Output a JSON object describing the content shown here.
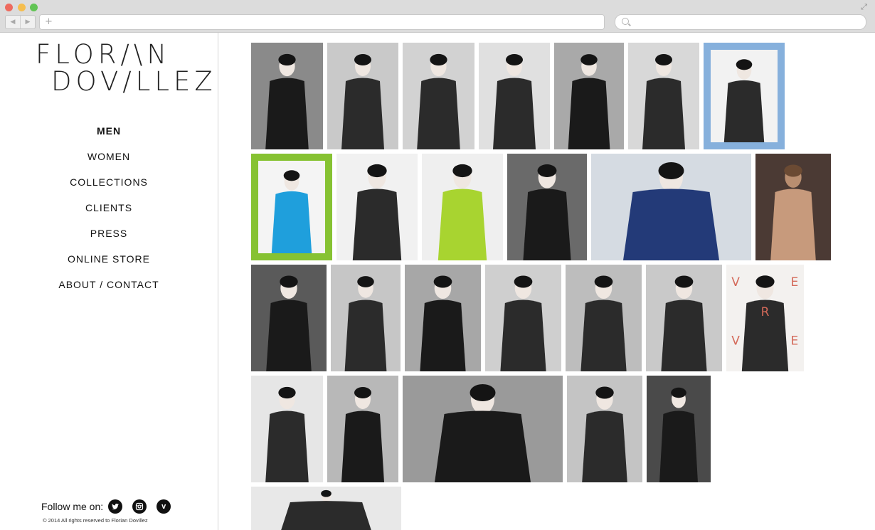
{
  "browser": {
    "url": "",
    "search_placeholder": ""
  },
  "site": {
    "logo_line1": "FLOR/\\N",
    "logo_line2": "DOV/LLEZ"
  },
  "nav": {
    "items": [
      {
        "label": "MEN",
        "active": true
      },
      {
        "label": "WOMEN",
        "active": false
      },
      {
        "label": "COLLECTIONS",
        "active": false
      },
      {
        "label": "CLIENTS",
        "active": false
      },
      {
        "label": "PRESS",
        "active": false
      },
      {
        "label": "ONLINE STORE",
        "active": false
      },
      {
        "label": "ABOUT / CONTACT",
        "active": false
      }
    ]
  },
  "footer": {
    "follow_label": "Follow me on:",
    "social": [
      {
        "name": "twitter-icon"
      },
      {
        "name": "instagram-icon"
      },
      {
        "name": "vimeo-icon",
        "glyph": "v"
      }
    ],
    "copyright": "© 2014 All rights reserved to Florian Dovillez"
  },
  "gallery": {
    "photos": [
      {
        "bg": "#8a8a8a",
        "tone": "dark",
        "frame": null
      },
      {
        "bg": "#c9c9c9",
        "tone": "light",
        "frame": null
      },
      {
        "bg": "#d2d2d2",
        "tone": "light",
        "frame": null
      },
      {
        "bg": "#e0e0e0",
        "tone": "light",
        "frame": null
      },
      {
        "bg": "#a9a9a9",
        "tone": "dark",
        "frame": null
      },
      {
        "bg": "#d8d8d8",
        "tone": "light",
        "frame": null
      },
      {
        "bg": "#f2f2f2",
        "tone": "light",
        "frame": "#86b0dc"
      },
      {
        "bg": "#f4f4f4",
        "tone": "light",
        "frame": "#86c232",
        "accent": "#1f9fdc"
      },
      {
        "bg": "#f1f1f1",
        "tone": "light",
        "frame": null
      },
      {
        "bg": "#efefef",
        "tone": "light",
        "frame": null,
        "accent": "#a8d430"
      },
      {
        "bg": "#6a6a6a",
        "tone": "dark",
        "frame": null
      },
      {
        "bg": "#d5dbe2",
        "tone": "light",
        "frame": null,
        "accent": "#233a78"
      },
      {
        "bg": "#4b3a34",
        "tone": "warm",
        "frame": null
      },
      {
        "bg": "#5a5a5a",
        "tone": "dark",
        "frame": null
      },
      {
        "bg": "#c6c6c6",
        "tone": "light",
        "frame": null
      },
      {
        "bg": "#a7a7a7",
        "tone": "dark",
        "frame": null
      },
      {
        "bg": "#cfcfcf",
        "tone": "light",
        "frame": null
      },
      {
        "bg": "#bdbdbd",
        "tone": "light",
        "frame": null
      },
      {
        "bg": "#c9c9c9",
        "tone": "light",
        "frame": null
      },
      {
        "bg": "#f3f1ef",
        "tone": "light",
        "frame": null,
        "letters": [
          "V",
          "E",
          "R",
          "V",
          "E"
        ]
      },
      {
        "bg": "#e6e6e6",
        "tone": "light",
        "frame": null
      },
      {
        "bg": "#b8b8b8",
        "tone": "dark",
        "frame": null
      },
      {
        "bg": "#9a9a9a",
        "tone": "dark",
        "frame": null
      },
      {
        "bg": "#c4c4c4",
        "tone": "light",
        "frame": null
      },
      {
        "bg": "#4a4a4a",
        "tone": "dark",
        "frame": null
      },
      {
        "bg": "#e8e8e8",
        "tone": "light",
        "frame": null
      }
    ]
  }
}
